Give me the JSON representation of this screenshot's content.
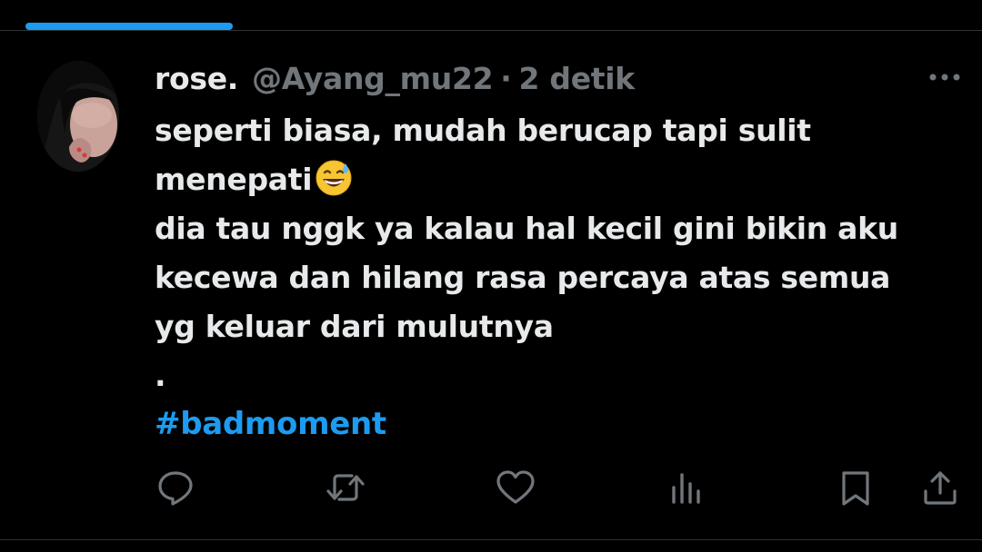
{
  "colors": {
    "background": "#000000",
    "text_primary": "#e7e9ea",
    "text_secondary": "#71767b",
    "accent": "#1d9bf0",
    "divider": "#2f3336"
  },
  "tweet": {
    "display_name": "rose.",
    "handle": "@Ayang_mu22",
    "separator": "·",
    "time_ago": "2 detik",
    "lines": [
      "seperti biasa, mudah berucap tapi sulit",
      "menepati",
      "dia tau nggk ya kalau hal kecil gini bikin aku",
      "kecewa dan hilang rasa percaya atas semua",
      "yg keluar dari mulutnya",
      "."
    ],
    "emoji": "grinning-face-with-sweat",
    "hashtag": "#badmoment"
  },
  "icons": {
    "more": "more-horizontal-icon",
    "reply": "reply-icon",
    "retweet": "retweet-icon",
    "like": "like-icon",
    "views": "views-icon",
    "bookmark": "bookmark-icon",
    "share": "share-icon"
  }
}
